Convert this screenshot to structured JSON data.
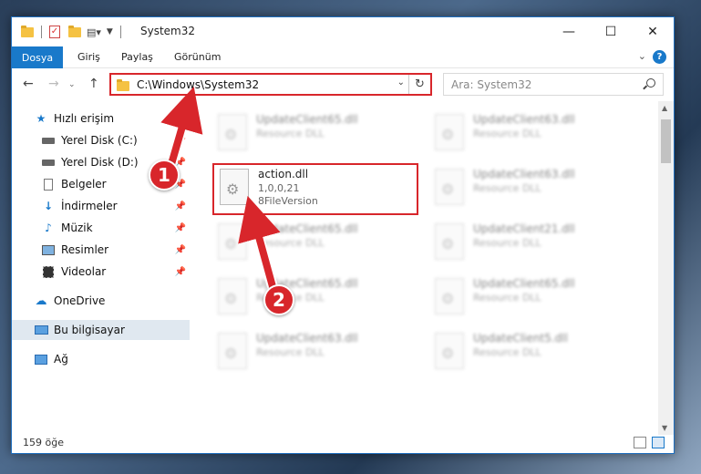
{
  "window": {
    "title": "System32",
    "controls": {
      "minimize": "—",
      "maximize": "☐",
      "close": "✕"
    }
  },
  "ribbon": {
    "tabs": [
      "Dosya",
      "Giriş",
      "Paylaş",
      "Görünüm"
    ]
  },
  "nav": {
    "address": "C:\\Windows\\System32",
    "search_placeholder": "Ara: System32"
  },
  "sidebar": {
    "items": [
      {
        "label": "Hızlı erişim",
        "icon": "star-icon"
      },
      {
        "label": "Yerel Disk (C:)",
        "icon": "drive-icon"
      },
      {
        "label": "Yerel Disk (D:)",
        "icon": "drive-icon"
      },
      {
        "label": "Belgeler",
        "icon": "documents-icon"
      },
      {
        "label": "İndirmeler",
        "icon": "download-icon"
      },
      {
        "label": "Müzik",
        "icon": "music-icon"
      },
      {
        "label": "Resimler",
        "icon": "pictures-icon"
      },
      {
        "label": "Videolar",
        "icon": "video-icon"
      },
      {
        "label": "OneDrive",
        "icon": "cloud-icon"
      },
      {
        "label": "Bu bilgisayar",
        "icon": "computer-icon"
      },
      {
        "label": "Ağ",
        "icon": "network-icon"
      }
    ]
  },
  "files": {
    "focused": {
      "name": "action.dll",
      "version": "1,0,0,21",
      "description": "8FileVersion"
    },
    "blurred_left": [
      {
        "name": "UpdateClient65.dll",
        "type": "Resource DLL"
      },
      {
        "name": "UpdateClient65.dll",
        "type": "Resource DLL"
      },
      {
        "name": "UpdateClient65.dll",
        "type": "Resource DLL"
      },
      {
        "name": "UpdateClient63.dll",
        "type": "Resource DLL"
      }
    ],
    "blurred_right": [
      {
        "name": "UpdateClient63.dll",
        "type": "Resource DLL"
      },
      {
        "name": "UpdateClient63.dll",
        "type": "Resource DLL"
      },
      {
        "name": "UpdateClient21.dll",
        "type": "Resource DLL"
      },
      {
        "name": "UpdateClient65.dll",
        "type": "Resource DLL"
      },
      {
        "name": "UpdateClient5.dll",
        "type": "Resource DLL"
      }
    ]
  },
  "status": {
    "count": "159 öğe"
  },
  "annotations": {
    "step1": "1",
    "step2": "2"
  },
  "colors": {
    "accent": "#1979ca",
    "highlight": "#d8262b"
  }
}
